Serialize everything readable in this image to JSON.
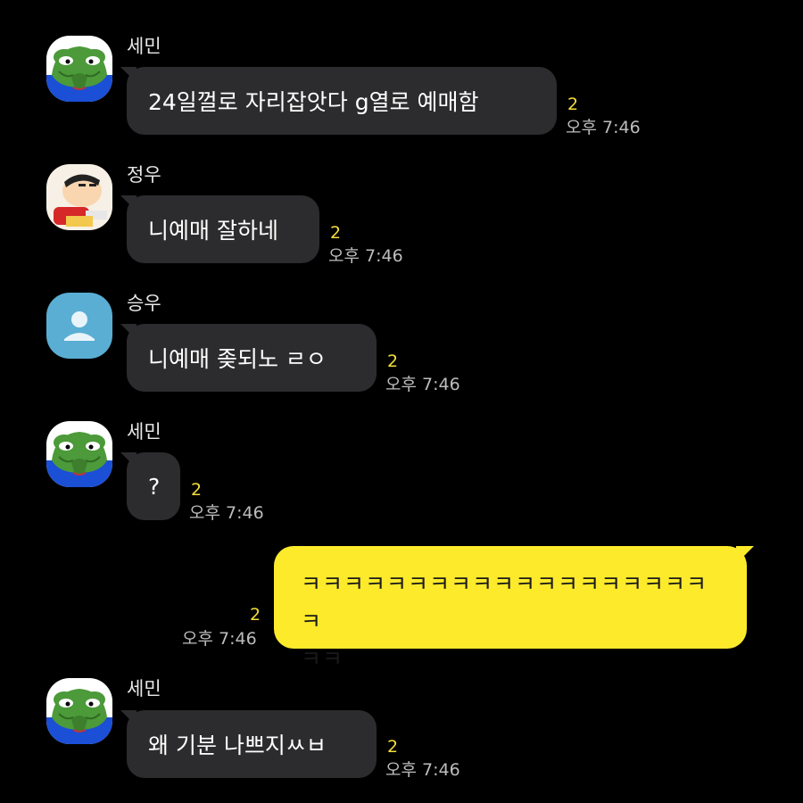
{
  "messages": [
    {
      "sender": "세민",
      "text": "24일껄로 자리잡앗다 g열로 예매함",
      "unread": "2",
      "time": "오후 7:46"
    },
    {
      "sender": "정우",
      "text": "니예매 잘하네",
      "unread": "2",
      "time": "오후 7:46"
    },
    {
      "sender": "승우",
      "text": "니예매 좆되노 ㄹㅇ",
      "unread": "2",
      "time": "오후 7:46"
    },
    {
      "sender": "세민",
      "text": "?",
      "unread": "2",
      "time": "오후 7:46"
    },
    {
      "sender": "",
      "text_line1": "ㅋㅋㅋㅋㅋㅋㅋㅋㅋㅋㅋㅋㅋㅋㅋㅋㅋㅋㅋㅋ",
      "text_line2": "ㅋㅋ",
      "unread": "2",
      "time": "오후 7:46"
    },
    {
      "sender": "세민",
      "text": "왜 기분 나쁘지ㅆㅂ",
      "unread": "2",
      "time": "오후 7:46"
    }
  ],
  "avatars": {
    "semin": "pepe-frog-avatar",
    "jungwoo": "shin-chan-avatar",
    "seungwoo": "default-person-avatar"
  },
  "colors": {
    "background": "#000000",
    "incoming_bubble": "#2c2c2e",
    "outgoing_bubble": "#fdea2b",
    "unread_count": "#f4de3a",
    "time_text": "#bdbdbd"
  }
}
